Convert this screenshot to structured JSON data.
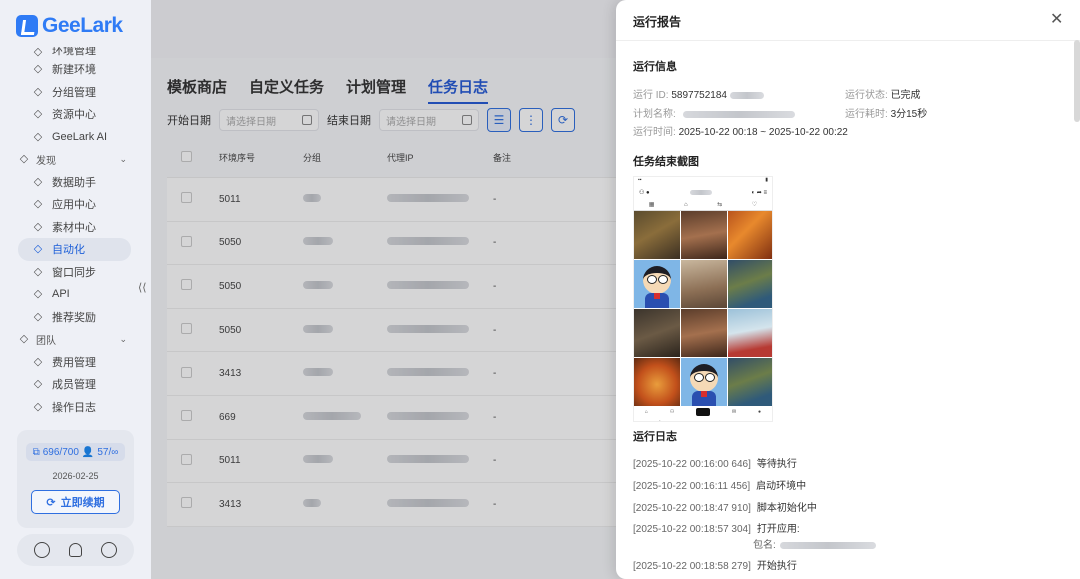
{
  "app": {
    "brand": "GeeLark"
  },
  "sidebar": {
    "items": [
      {
        "label": "环境管理",
        "icon": "monitor-icon",
        "type": "item"
      },
      {
        "label": "新建环境",
        "icon": "edit-icon",
        "type": "item"
      },
      {
        "label": "分组管理",
        "icon": "list-icon",
        "type": "item"
      },
      {
        "label": "资源中心",
        "icon": "grid-icon",
        "type": "item"
      },
      {
        "label": "GeeLark AI",
        "icon": "ai-icon",
        "type": "item"
      },
      {
        "label": "发现",
        "icon": "eye-icon",
        "type": "section"
      },
      {
        "label": "数据助手",
        "icon": "chart-icon",
        "type": "item"
      },
      {
        "label": "应用中心",
        "icon": "apps-icon",
        "type": "item"
      },
      {
        "label": "素材中心",
        "icon": "image-icon",
        "type": "item"
      },
      {
        "label": "自动化",
        "icon": "robot-icon",
        "type": "item",
        "active": true
      },
      {
        "label": "窗口同步",
        "icon": "sync-icon",
        "type": "item"
      },
      {
        "label": "API",
        "icon": "api-icon",
        "type": "item"
      },
      {
        "label": "推荐奖励",
        "icon": "dollar-icon",
        "type": "item"
      },
      {
        "label": "团队",
        "icon": "team-icon",
        "type": "section"
      },
      {
        "label": "费用管理",
        "icon": "bill-icon",
        "type": "item"
      },
      {
        "label": "成员管理",
        "icon": "user-icon",
        "type": "item"
      },
      {
        "label": "操作日志",
        "icon": "log-icon",
        "type": "item"
      }
    ],
    "collapse_glyph": "⟨⟨",
    "quota": {
      "devices": "696/700",
      "members": "57/∞",
      "expiry": "2026-02-25",
      "renew_label": "立即续期"
    }
  },
  "main": {
    "tabs": [
      "模板商店",
      "自定义任务",
      "计划管理",
      "任务日志"
    ],
    "active_tab": 3,
    "filters": {
      "start_label": "开始日期",
      "start_placeholder": "请选择日期",
      "end_label": "结束日期",
      "end_placeholder": "请选择日期"
    },
    "table": {
      "headers": [
        "环境序号",
        "分组",
        "代理IP",
        "备注"
      ],
      "rows": [
        {
          "id": "5011",
          "note": "-"
        },
        {
          "id": "5050",
          "note": "-"
        },
        {
          "id": "5050",
          "note": "-"
        },
        {
          "id": "5050",
          "note": "-"
        },
        {
          "id": "3413",
          "note": "-"
        },
        {
          "id": "669",
          "note": "-"
        },
        {
          "id": "5011",
          "note": "-"
        },
        {
          "id": "3413",
          "note": "-"
        }
      ]
    }
  },
  "drawer": {
    "title": "运行报告",
    "info_title": "运行信息",
    "run_id_label": "运行 ID:",
    "run_id_value": "5897752184",
    "plan_label": "计划名称:",
    "time_label": "运行时间:",
    "time_value": "2025-10-22 00:18 ~ 2025-10-22 00:22",
    "status_label": "运行状态:",
    "status_value": "已完成",
    "duration_label": "运行耗时:",
    "duration_value": "3分15秒",
    "screenshot_title": "任务结束截图",
    "log_title": "运行日志",
    "logs": [
      {
        "time": "[2025-10-22 00:16:00 646]",
        "msg": "等待执行"
      },
      {
        "time": "[2025-10-22 00:16:11 456]",
        "msg": "启动环境中"
      },
      {
        "time": "[2025-10-22 00:18:47 910]",
        "msg": "脚本初始化中"
      },
      {
        "time": "[2025-10-22 00:18:57 304]",
        "msg": "打开应用:"
      },
      {
        "time": "[2025-10-22 00:18:58 279]",
        "msg": "开始执行"
      }
    ],
    "package_label": "包名:"
  }
}
